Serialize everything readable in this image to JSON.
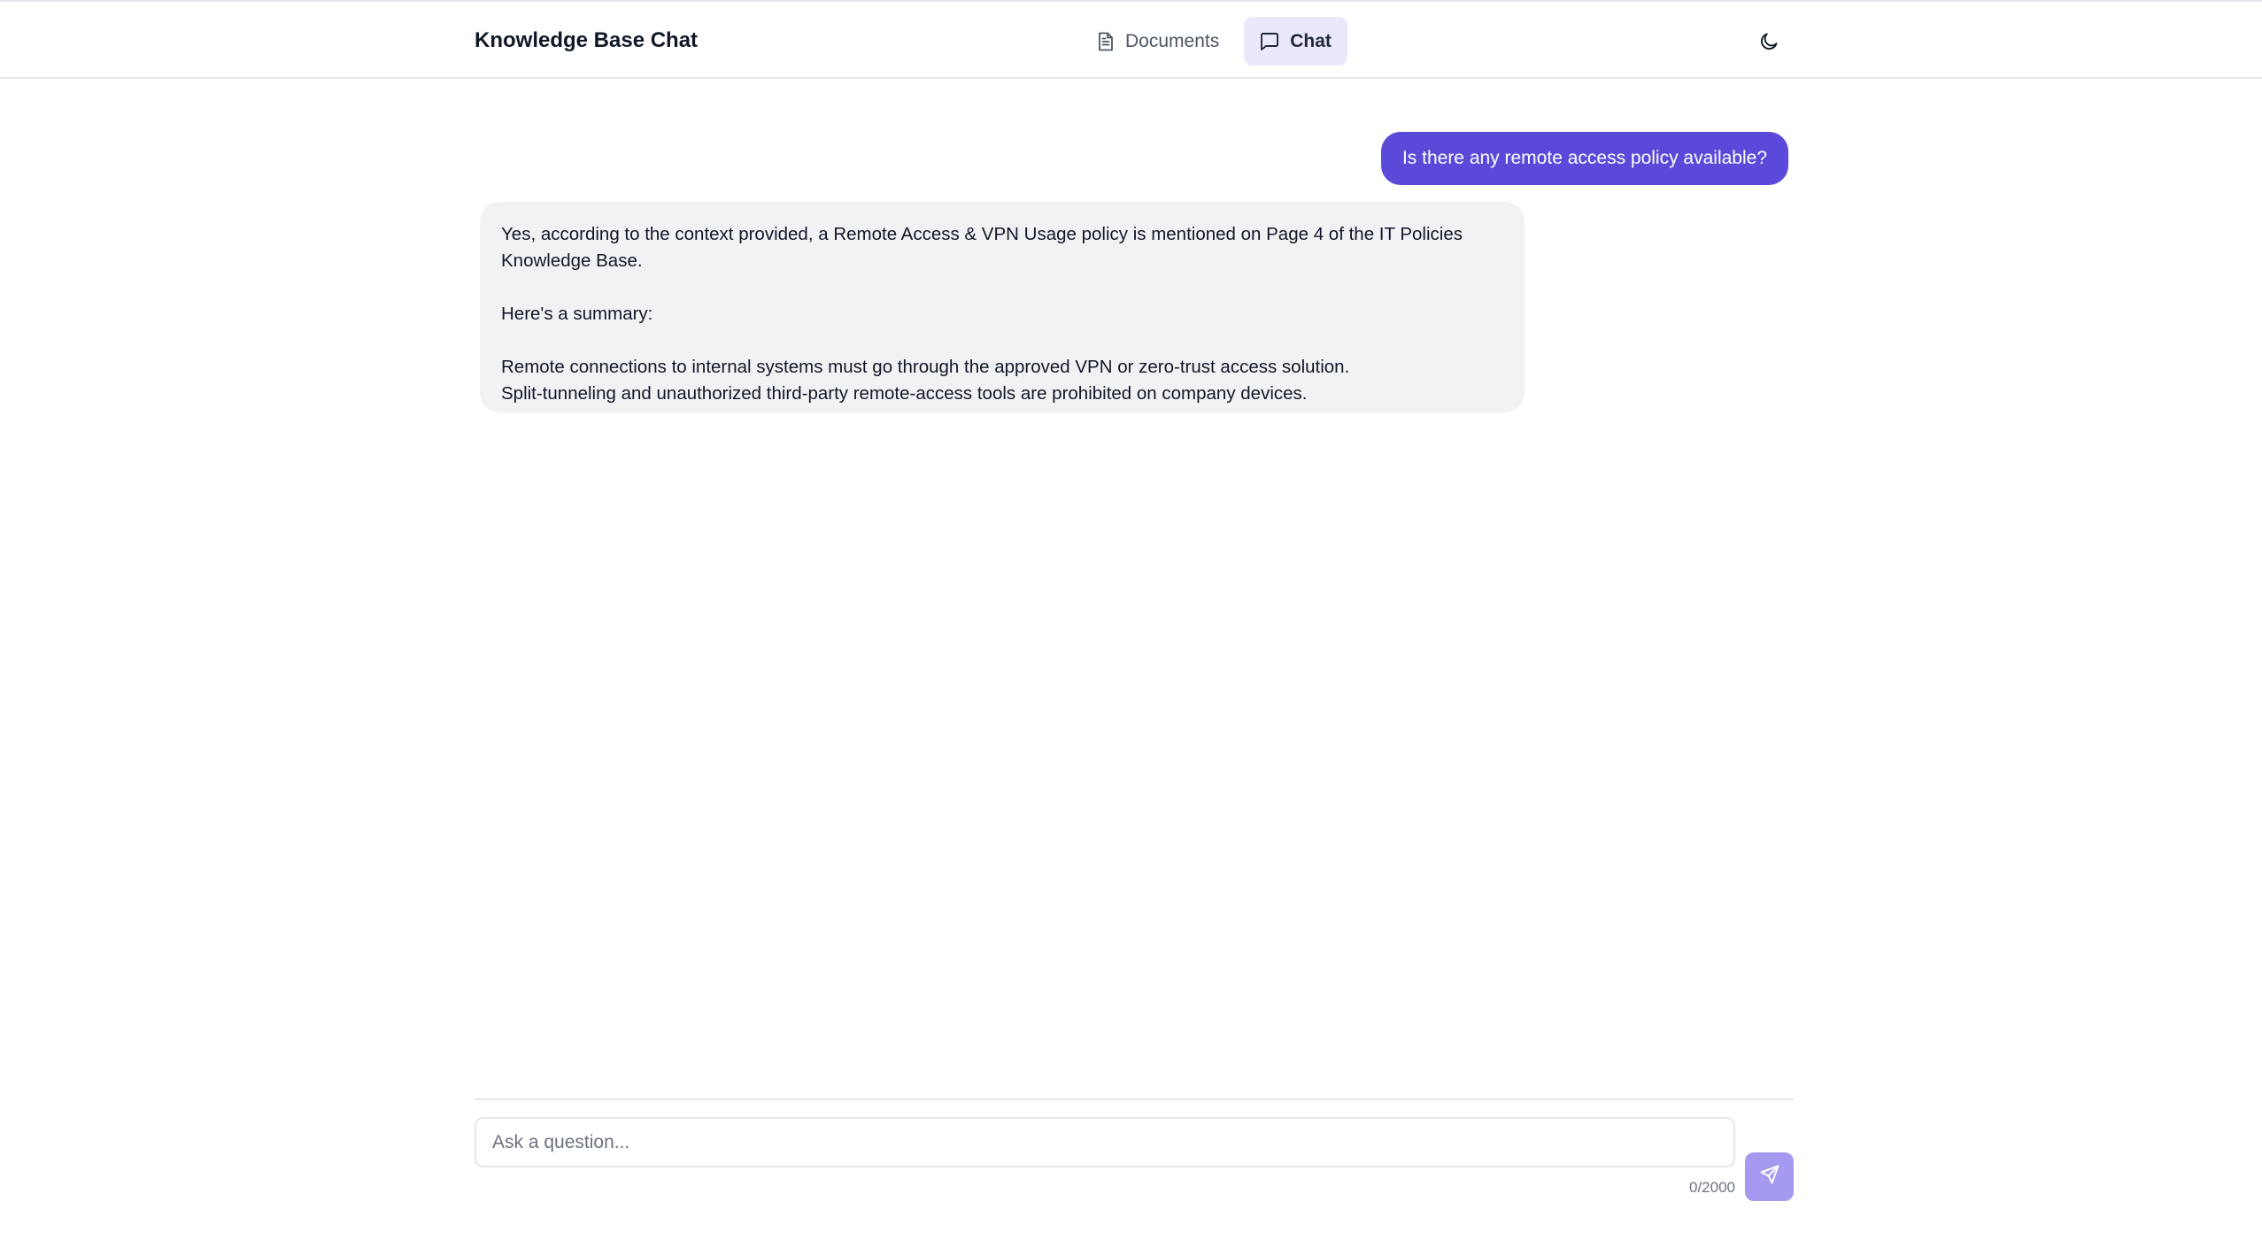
{
  "header": {
    "title": "Knowledge Base Chat",
    "tabs": [
      {
        "label": "Documents",
        "icon": "document-icon",
        "active": false
      },
      {
        "label": "Chat",
        "icon": "chat-bubble-icon",
        "active": true
      }
    ],
    "theme_toggle_icon": "moon-icon"
  },
  "messages": {
    "user": {
      "text": "Is there any remote access policy available?"
    },
    "assistant": {
      "line1": "Yes, according to the context provided, a Remote Access & VPN Usage policy is mentioned on Page 4 of the IT Policies Knowledge Base.",
      "line2": "Here's a summary:",
      "line3": "Remote connections to internal systems must go through the approved VPN or zero-trust access solution.",
      "line4": "Split-tunneling and unauthorized third-party remote-access tools are prohibited on company devices."
    }
  },
  "composer": {
    "placeholder": "Ask a question...",
    "value": "",
    "char_count": "0/2000",
    "send_icon": "send-icon"
  },
  "colors": {
    "accent": "#5b4ad9",
    "active_tab_bg": "#ebe8fb",
    "assistant_bubble_bg": "#f1f2f4",
    "send_button_bg": "#a49bf0"
  }
}
